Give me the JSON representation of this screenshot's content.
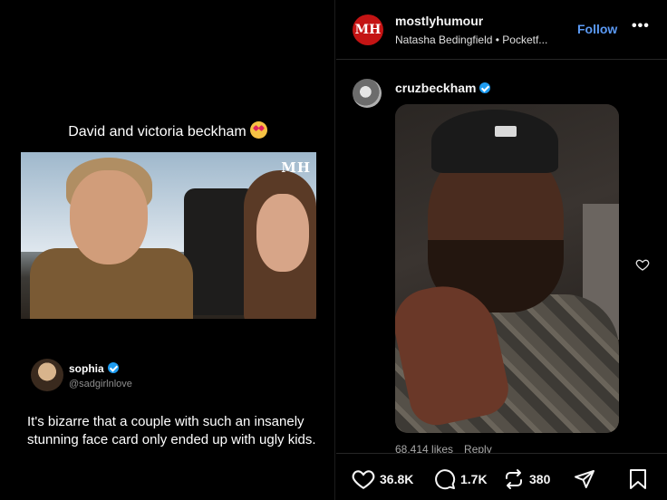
{
  "media": {
    "caption": "David and victoria beckham",
    "caption_emoji": "heart-eyes-emoji",
    "watermark": "MH",
    "tweet": {
      "name": "sophia",
      "handle": "@sadgirlnlove",
      "text": "It's bizarre that a couple with such an insanely stunning face card only ended up with ugly kids."
    }
  },
  "post": {
    "avatar_text": "MH",
    "account": "mostlyhumour",
    "audio": "Natasha Bedingfield • Pocketf...",
    "follow_label": "Follow",
    "more_label": "•••"
  },
  "comment": {
    "user": "cruzbeckham",
    "likes": "68,414 likes",
    "reply_label": "Reply"
  },
  "actions": {
    "likes": "36.8K",
    "comments": "1.7K",
    "reposts": "380"
  },
  "colors": {
    "accent": "#5b9af5",
    "verified": "#1d9bf0",
    "brand": "#c41414"
  }
}
